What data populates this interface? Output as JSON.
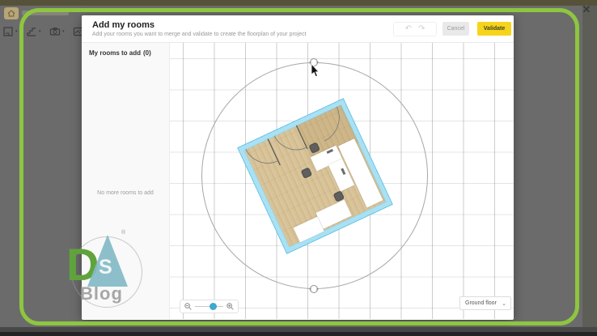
{
  "frame": {
    "accent_color": "#8dc63f"
  },
  "window": {
    "close_glyph": "✕"
  },
  "background_app": {
    "toolbar_icons": [
      "home-icon",
      "room-tool-icon",
      "stairs-tool-icon",
      "camera-icon",
      "frame-tool-icon"
    ]
  },
  "modal": {
    "title": "Add my rooms",
    "subtitle": "Add your rooms you want to merge and validate to create the floorplan of your project",
    "undo_glyph": "↶",
    "redo_glyph": "↷",
    "cancel_label": "Cancel",
    "validate_label": "Validate",
    "validate_bg": "#f6d41c"
  },
  "sidebar": {
    "heading_label": "My rooms to add",
    "heading_count": "(0)",
    "empty_message": "No more rooms to add"
  },
  "canvas": {
    "floor_selector_value": "Ground floor",
    "floor_selector_chevron": "⌄",
    "zoom_thumb_position_pct": 52,
    "zoom_thumb_color": "#3fa9cf",
    "plan": {
      "rotation_deg": -25,
      "wall_color": "#a9e1f3",
      "floor_wood_color": "#d7c298",
      "selection_circle": true,
      "doors": 3,
      "furniture": [
        "desk-l-shape",
        "wardrobe",
        "bottom-cabinet",
        "corner-block",
        "chair",
        "chair",
        "chair"
      ]
    }
  },
  "watermark": {
    "letter_d": "D",
    "letter_s": "S",
    "word": "Blog",
    "registered_glyph": "®",
    "d_color": "#60a33c",
    "s_triangle_color": "#83bac6"
  }
}
